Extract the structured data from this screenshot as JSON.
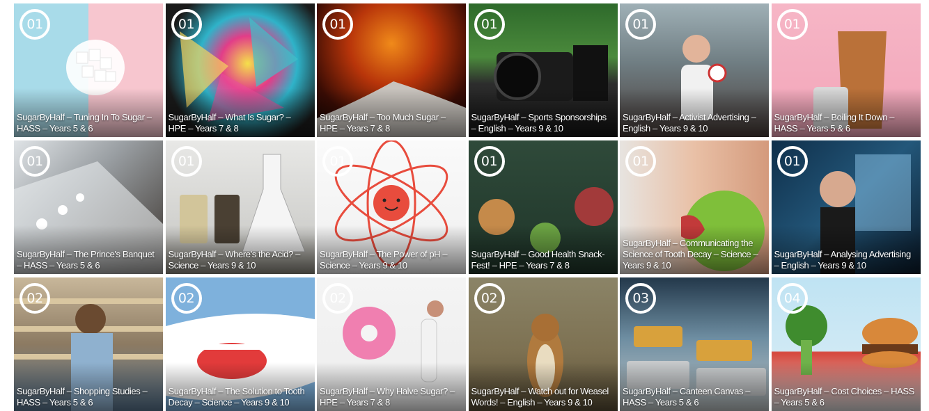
{
  "tiles": [
    {
      "number": "01",
      "title": "SugarByHalf – Tuning In To Sugar – HASS – Years 5 & 6",
      "bg": "linear-gradient(90deg,#a8dbe9 0%,#a8dbe9 50%,#f7c6cf 50%,#f7c6cf 100%)"
    },
    {
      "number": "01",
      "title": "SugarByHalf – What Is Sugar? – HPE – Years 7 & 8",
      "bg": "radial-gradient(circle at 55% 45%,#f5e04a 0%,#e23d88 25%,#2fb3c9 45%,#1a1a1a 75%)"
    },
    {
      "number": "01",
      "title": "SugarByHalf – Too Much Sugar – HPE – Years 7 & 8",
      "bg": "radial-gradient(circle at 50% 30%,#f08a1a 0%,#b8350a 35%,#3a0c04 70%,#140403 100%)"
    },
    {
      "number": "01",
      "title": "SugarByHalf – Sports Sponsorships – English – Years 9 & 10",
      "bg": "linear-gradient(180deg,#2e6a2b 0%,#4b8a3c 40%,#2d2d2d 60%,#151515 100%)"
    },
    {
      "number": "01",
      "title": "SugarByHalf – Activist Advertising – English – Years 9 & 10",
      "bg": "linear-gradient(180deg,#9fb0b6 0%,#6f7d82 45%,#4a3e3a 100%)"
    },
    {
      "number": "01",
      "title": "SugarByHalf – Boiling It Down – HASS – Years 5 & 6",
      "bg": "linear-gradient(180deg,#f6b6c6 0%,#f2a5b9 100%)"
    },
    {
      "number": "01",
      "title": "SugarByHalf – The Prince's Banquet – HASS – Years 5 & 6",
      "bg": "linear-gradient(135deg,#dfe3e6 0%,#9a9fa3 40%,#3a332d 100%)"
    },
    {
      "number": "01",
      "title": "SugarByHalf – Where's the Acid? – Science – Years 9 & 10",
      "bg": "linear-gradient(180deg,#e8e8e6 0%,#cfcfcc 70%,#8d8a80 100%)"
    },
    {
      "number": "01",
      "title": "SugarByHalf – The Power of pH – Science – Years 9 & 10",
      "bg": "linear-gradient(180deg,#fafafa 0%,#efefef 100%)"
    },
    {
      "number": "01",
      "title": "SugarByHalf – Good Health Snack-Fest! – HPE – Years 7 & 8",
      "bg": "linear-gradient(180deg,#2f4a3a 0%,#1f3529 100%)"
    },
    {
      "number": "01",
      "title": "SugarByHalf – Communicating the Science of Tooth Decay – Science – Years 9 & 10",
      "bg": "linear-gradient(90deg,#e7e4e0 0%,#e9c0a6 50%,#d49a7c 100%)"
    },
    {
      "number": "01",
      "title": "SugarByHalf – Analysing Advertising – English – Years 9 & 10",
      "bg": "linear-gradient(135deg,#0f2f4a 0%,#23577a 50%,#0a1a2a 100%)"
    },
    {
      "number": "02",
      "title": "SugarByHalf – Shopping Studies – HASS – Years 5 & 6",
      "bg": "linear-gradient(180deg,#c8b79a 0%,#8c7a62 50%,#5c7a95 100%)"
    },
    {
      "number": "02",
      "title": "SugarByHalf – The Solution to Tooth Decay – Science – Years 9 & 10",
      "bg": "linear-gradient(180deg,#7eb1dc 0%,#7eb1dc 100%)"
    },
    {
      "number": "02",
      "title": "SugarByHalf – Why Halve Sugar? – HPE – Years 7 & 8",
      "bg": "linear-gradient(180deg,#f4f4f4 0%,#ededed 100%)"
    },
    {
      "number": "02",
      "title": "SugarByHalf – Watch out for Weasel Words! – English – Years 9 & 10",
      "bg": "linear-gradient(180deg,#8b8467 0%,#7d7152 55%,#5a4f37 100%)"
    },
    {
      "number": "03",
      "title": "SugarByHalf – Canteen Canvas – HASS – Years 5 & 6",
      "bg": "linear-gradient(180deg,#23384a 0%,#6d8da1 45%,#c1c7c8 100%)"
    },
    {
      "number": "04",
      "title": "SugarByHalf – Cost Choices – HASS – Years 5 & 6",
      "bg": "linear-gradient(180deg,#bfe3f3 0%,#cfe9f4 55%,#d6473c 56%,#e0e0e0 100%)"
    }
  ]
}
